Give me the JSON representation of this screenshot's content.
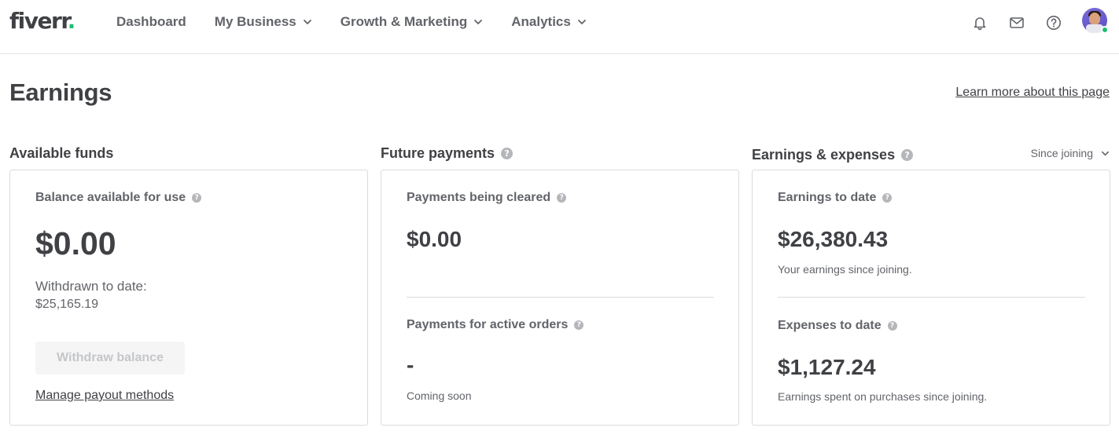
{
  "brand": {
    "logo_text": "fiverr",
    "logo_dot": ".",
    "accent": "#1dbf73"
  },
  "nav": {
    "items": [
      {
        "label": "Dashboard",
        "dropdown": false
      },
      {
        "label": "My Business",
        "dropdown": true
      },
      {
        "label": "Growth & Marketing",
        "dropdown": true
      },
      {
        "label": "Analytics",
        "dropdown": true
      }
    ],
    "icons": [
      "bell-icon",
      "mail-icon",
      "help-icon"
    ],
    "user": {
      "online": true
    }
  },
  "page": {
    "title": "Earnings",
    "learn_more": "Learn more about this page"
  },
  "available_funds": {
    "title": "Available funds",
    "balance_label": "Balance available for use",
    "balance_value": "$0.00",
    "withdrawn_label": "Withdrawn to date:",
    "withdrawn_value": "$25,165.19",
    "withdraw_button": "Withdraw balance",
    "manage_link": "Manage payout methods"
  },
  "future_payments": {
    "title": "Future payments",
    "clearing_label": "Payments being cleared",
    "clearing_value": "$0.00",
    "active_label": "Payments for active orders",
    "active_value": "-",
    "active_note": "Coming soon"
  },
  "earnings_expenses": {
    "title": "Earnings & expenses",
    "period": "Since joining",
    "earnings_label": "Earnings to date",
    "earnings_value": "$26,380.43",
    "earnings_note": "Your earnings since joining.",
    "expenses_label": "Expenses to date",
    "expenses_value": "$1,127.24",
    "expenses_note": "Earnings spent on purchases since joining."
  }
}
